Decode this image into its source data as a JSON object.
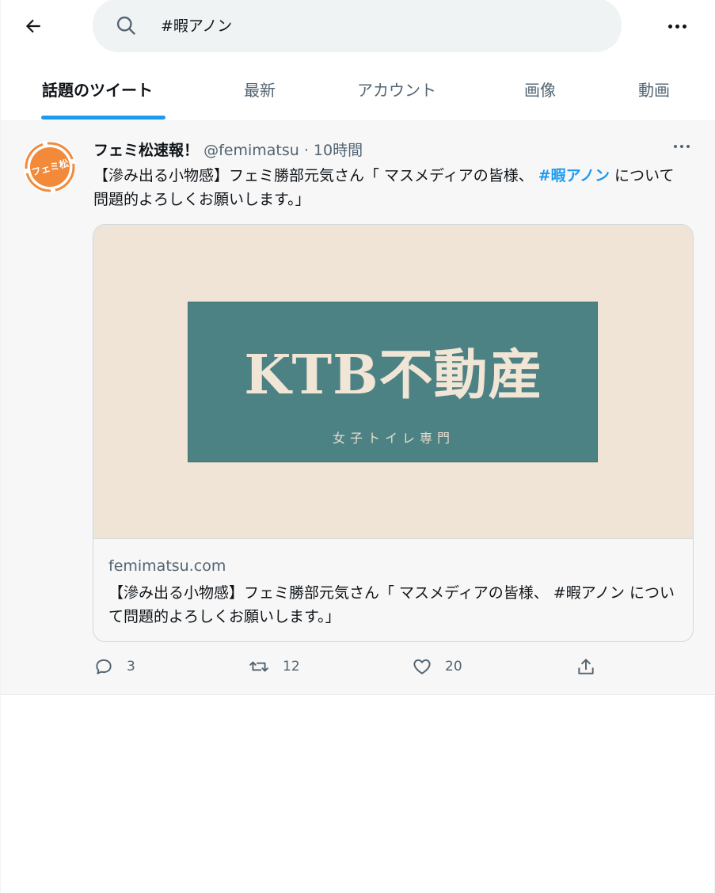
{
  "header": {
    "search_query": "#暇アノン"
  },
  "tabs": [
    {
      "label": "話題のツイート",
      "active": true
    },
    {
      "label": "最新",
      "active": false
    },
    {
      "label": "アカウント",
      "active": false
    },
    {
      "label": "画像",
      "active": false
    },
    {
      "label": "動画",
      "active": false
    }
  ],
  "tweet": {
    "author_name": "フェミ松速報！",
    "handle": "@femimatsu",
    "separator": " · ",
    "time": "10時間",
    "avatar_text": "フェミ松",
    "text_before": "【滲み出る小物感】フェミ勝部元気さん「 マスメディアの皆様、 ",
    "hashtag": "#暇アノン",
    "text_after": " について問題的よろしくお願いします。」",
    "card": {
      "image_title": "KTB不動産",
      "image_subtitle": "女子トイレ専門",
      "domain": "femimatsu.com",
      "title": "【滲み出る小物感】フェミ勝部元気さん「 マスメディアの皆様、 #暇アノン について問題的よろしくお願いします。」"
    },
    "actions": {
      "replies": "3",
      "retweets": "12",
      "likes": "20"
    }
  },
  "colors": {
    "accent": "#1d9bf0",
    "avatar_orange": "#f28a3a",
    "card_bg": "#f0e4d6",
    "card_box": "#4d8285"
  }
}
